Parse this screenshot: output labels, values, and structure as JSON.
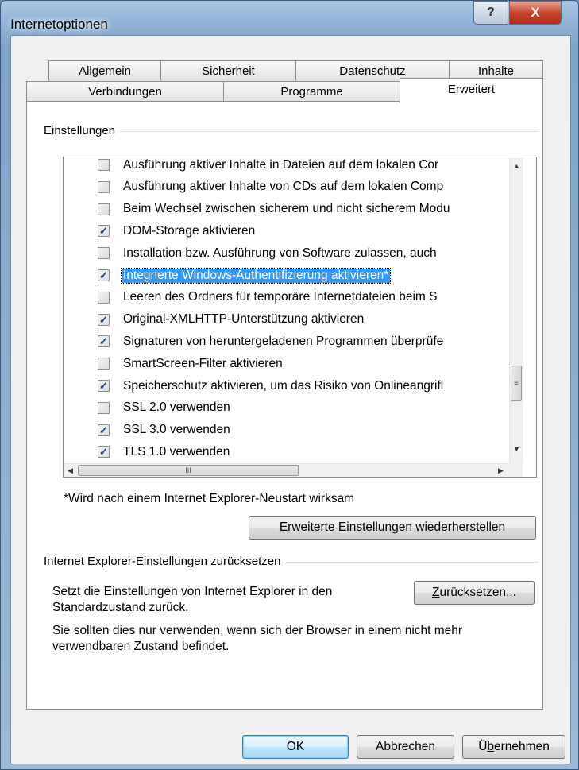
{
  "window": {
    "title": "Internetoptionen",
    "help_label": "?",
    "close_label": "X"
  },
  "tabs": {
    "row_back": [
      "Allgemein",
      "Sicherheit",
      "Datenschutz",
      "Inhalte"
    ],
    "row_front": [
      "Verbindungen",
      "Programme",
      "Erweitert"
    ],
    "active": "Erweitert"
  },
  "settings": {
    "group_label": "Einstellungen",
    "items": [
      {
        "label": "Ausführung aktiver Inhalte in Dateien auf dem lokalen Cor",
        "checked": false
      },
      {
        "label": "Ausführung aktiver Inhalte von CDs auf dem lokalen Comp",
        "checked": false
      },
      {
        "label": "Beim Wechsel zwischen sicherem und nicht sicherem Modu",
        "checked": false
      },
      {
        "label": "DOM-Storage aktivieren",
        "checked": true
      },
      {
        "label": "Installation bzw. Ausführung von Software zulassen, auch",
        "checked": false
      },
      {
        "label": "Integrierte Windows-Authentifizierung aktivieren*",
        "checked": true,
        "selected": true
      },
      {
        "label": "Leeren des Ordners für temporäre Internetdateien beim S",
        "checked": false
      },
      {
        "label": "Original-XMLHTTP-Unterstützung aktivieren",
        "checked": true
      },
      {
        "label": "Signaturen von heruntergeladenen Programmen überprüfe",
        "checked": true
      },
      {
        "label": "SmartScreen-Filter aktivieren",
        "checked": false
      },
      {
        "label": "Speicherschutz aktivieren, um das Risiko von Onlineangrifl",
        "checked": true
      },
      {
        "label": "SSL 2.0 verwenden",
        "checked": false
      },
      {
        "label": "SSL 3.0 verwenden",
        "checked": true
      },
      {
        "label": "TLS 1.0 verwenden",
        "checked": true
      }
    ],
    "scrollbar_glyphs": {
      "up": "▲",
      "down": "▼",
      "left": "◀",
      "right": "▶",
      "vthumb": "≡",
      "hthumb": "III"
    },
    "restart_note": "*Wird nach einem Internet Explorer-Neustart wirksam",
    "restore_button": {
      "accel": "E",
      "rest": "rweiterte Einstellungen wiederherstellen"
    }
  },
  "reset_section": {
    "group_label": "Internet Explorer-Einstellungen zurücksetzen",
    "description": "Setzt die Einstellungen von Internet Explorer in den Standardzustand zurück.",
    "reset_button": {
      "accel": "Z",
      "rest": "urücksetzen..."
    },
    "hint": "Sie sollten dies nur verwenden, wenn sich der Browser in einem nicht mehr verwendbaren Zustand befindet."
  },
  "footer": {
    "ok": "OK",
    "cancel": "Abbrechen",
    "apply": {
      "pre": "Ü",
      "accel": "b",
      "rest": "ernehmen"
    }
  }
}
